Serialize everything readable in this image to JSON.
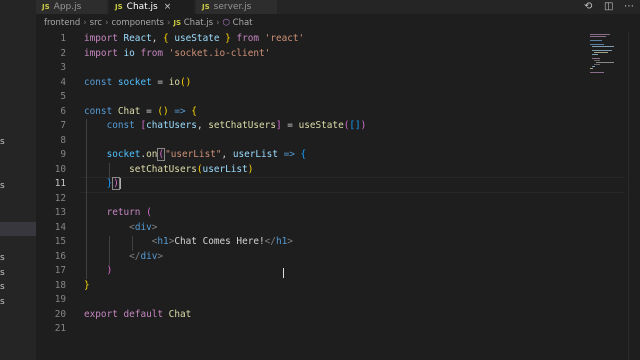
{
  "tabs": [
    {
      "icon": "JS",
      "label": "App.js",
      "active": false
    },
    {
      "icon": "JS",
      "label": "Chat.js",
      "active": true,
      "close": "×"
    },
    {
      "icon": "JS",
      "label": "server.js",
      "active": false
    }
  ],
  "breadcrumb": [
    "frontend",
    "src",
    "components",
    "Chat.js",
    "Chat"
  ],
  "sidebar_fragments": [
    "s",
    "s",
    "s",
    "s",
    "s",
    "s"
  ],
  "editor": {
    "current_line": 11,
    "line_numbers": [
      "1",
      "2",
      "3",
      "4",
      "5",
      "6",
      "7",
      "8",
      "9",
      "10",
      "11",
      "12",
      "13",
      "14",
      "15",
      "16",
      "17",
      "18",
      "19",
      "20",
      "21"
    ]
  },
  "colors": {
    "editor_bg": "#1e1e1e",
    "keyword": "#c586c0",
    "string": "#ce9178",
    "variable": "#9cdcfe",
    "function": "#dcdcaa",
    "js_icon": "#cbcb41"
  },
  "icons": {
    "split": "split-editor-icon",
    "compare": "compare-icon",
    "more": "more-actions-icon"
  }
}
